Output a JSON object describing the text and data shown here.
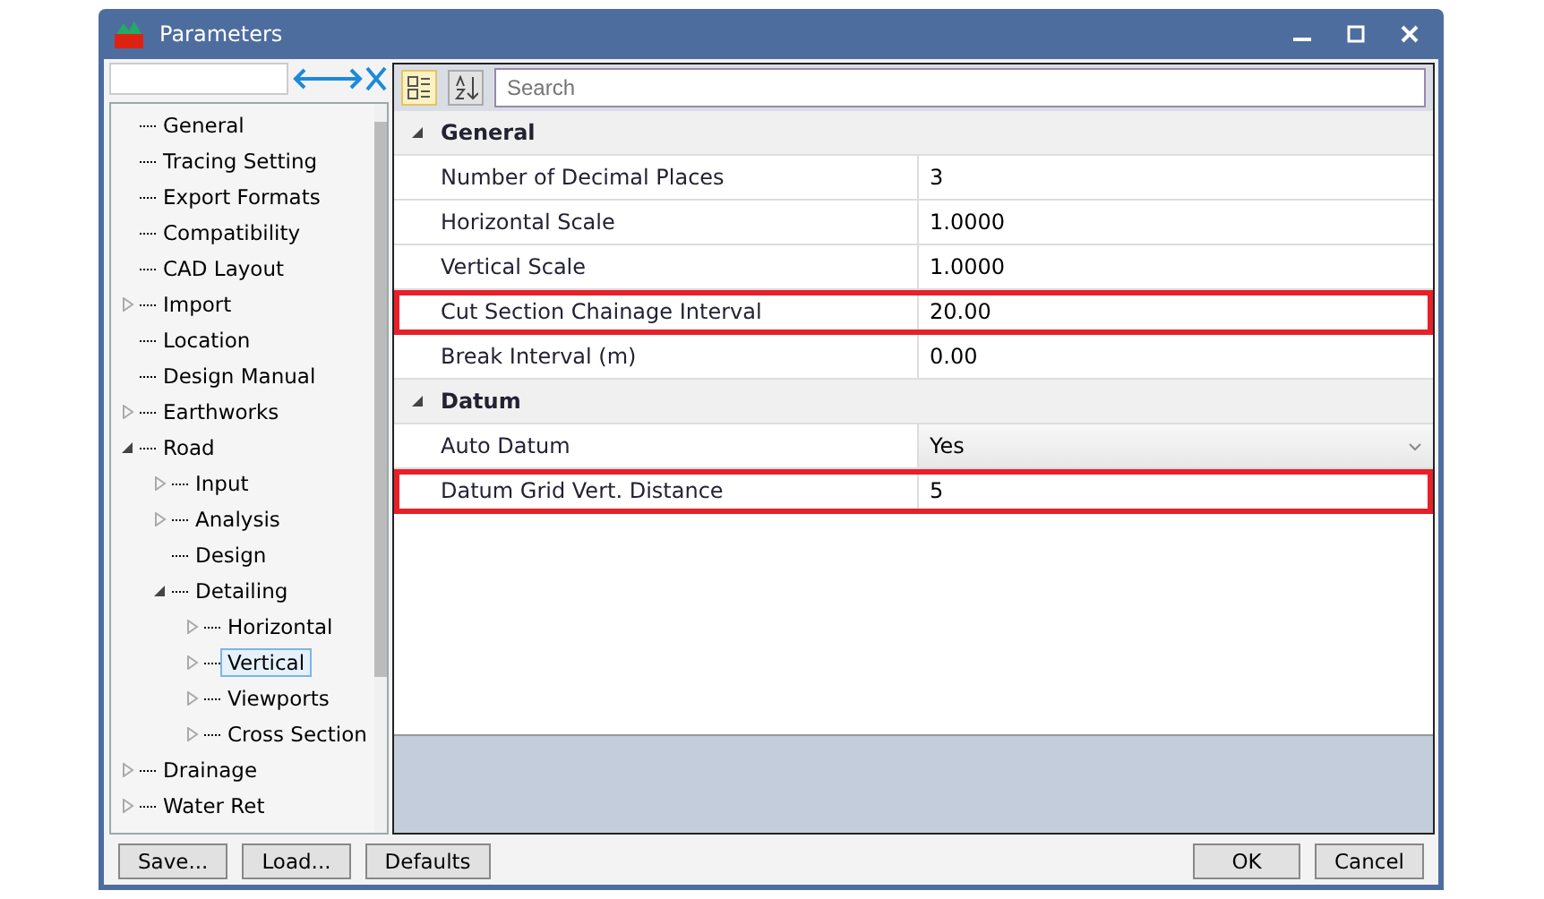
{
  "window": {
    "title": "Parameters"
  },
  "tree": [
    {
      "label": "General",
      "kind": "leaf",
      "selected": false
    },
    {
      "label": "Tracing Setting",
      "kind": "leaf",
      "selected": false
    },
    {
      "label": "Export Formats",
      "kind": "leaf",
      "selected": false
    },
    {
      "label": "Compatibility",
      "kind": "leaf",
      "selected": false
    },
    {
      "label": "CAD Layout",
      "kind": "leaf",
      "selected": false
    },
    {
      "label": "Import",
      "kind": "node",
      "expanded": false,
      "selected": false
    },
    {
      "label": "Location",
      "kind": "leaf",
      "selected": false
    },
    {
      "label": "Design Manual",
      "kind": "leaf",
      "selected": false
    },
    {
      "label": "Earthworks",
      "kind": "node",
      "expanded": false,
      "selected": false
    },
    {
      "label": "Road",
      "kind": "node",
      "expanded": true,
      "selected": false,
      "children": [
        {
          "label": "Input",
          "kind": "node",
          "expanded": false,
          "selected": false
        },
        {
          "label": "Analysis",
          "kind": "node",
          "expanded": false,
          "selected": false
        },
        {
          "label": "Design",
          "kind": "leaf",
          "selected": false
        },
        {
          "label": "Detailing",
          "kind": "node",
          "expanded": true,
          "selected": false,
          "children": [
            {
              "label": "Horizontal",
              "kind": "node",
              "expanded": false,
              "selected": false
            },
            {
              "label": "Vertical",
              "kind": "node",
              "expanded": false,
              "selected": true
            },
            {
              "label": "Viewports",
              "kind": "node",
              "expanded": false,
              "selected": false
            },
            {
              "label": "Cross Section",
              "kind": "node",
              "expanded": false,
              "selected": false
            }
          ]
        }
      ]
    },
    {
      "label": "Drainage",
      "kind": "node",
      "expanded": false,
      "selected": false
    },
    {
      "label": "Water Ret",
      "kind": "node",
      "expanded": false,
      "selected": false
    }
  ],
  "search": {
    "placeholder": "Search"
  },
  "categories": [
    {
      "name": "General",
      "expanded": true,
      "rows": [
        {
          "name": "Number of Decimal Places",
          "value": "3",
          "kind": "text",
          "highlighted": false
        },
        {
          "name": "Horizontal Scale",
          "value": "1.0000",
          "kind": "text",
          "highlighted": false
        },
        {
          "name": "Vertical Scale",
          "value": "1.0000",
          "kind": "text",
          "highlighted": false
        },
        {
          "name": "Cut Section Chainage Interval",
          "value": "20.00",
          "kind": "text",
          "highlighted": true
        },
        {
          "name": "Break Interval (m)",
          "value": "0.00",
          "kind": "text",
          "highlighted": false
        }
      ]
    },
    {
      "name": "Datum",
      "expanded": true,
      "rows": [
        {
          "name": "Auto Datum",
          "value": "Yes",
          "kind": "dropdown",
          "highlighted": false
        },
        {
          "name": "Datum Grid Vert. Distance",
          "value": "5",
          "kind": "text",
          "highlighted": true
        }
      ]
    }
  ],
  "buttons_left": [
    "Save...",
    "Load...",
    "Defaults"
  ],
  "buttons_right": [
    "OK",
    "Cancel"
  ]
}
